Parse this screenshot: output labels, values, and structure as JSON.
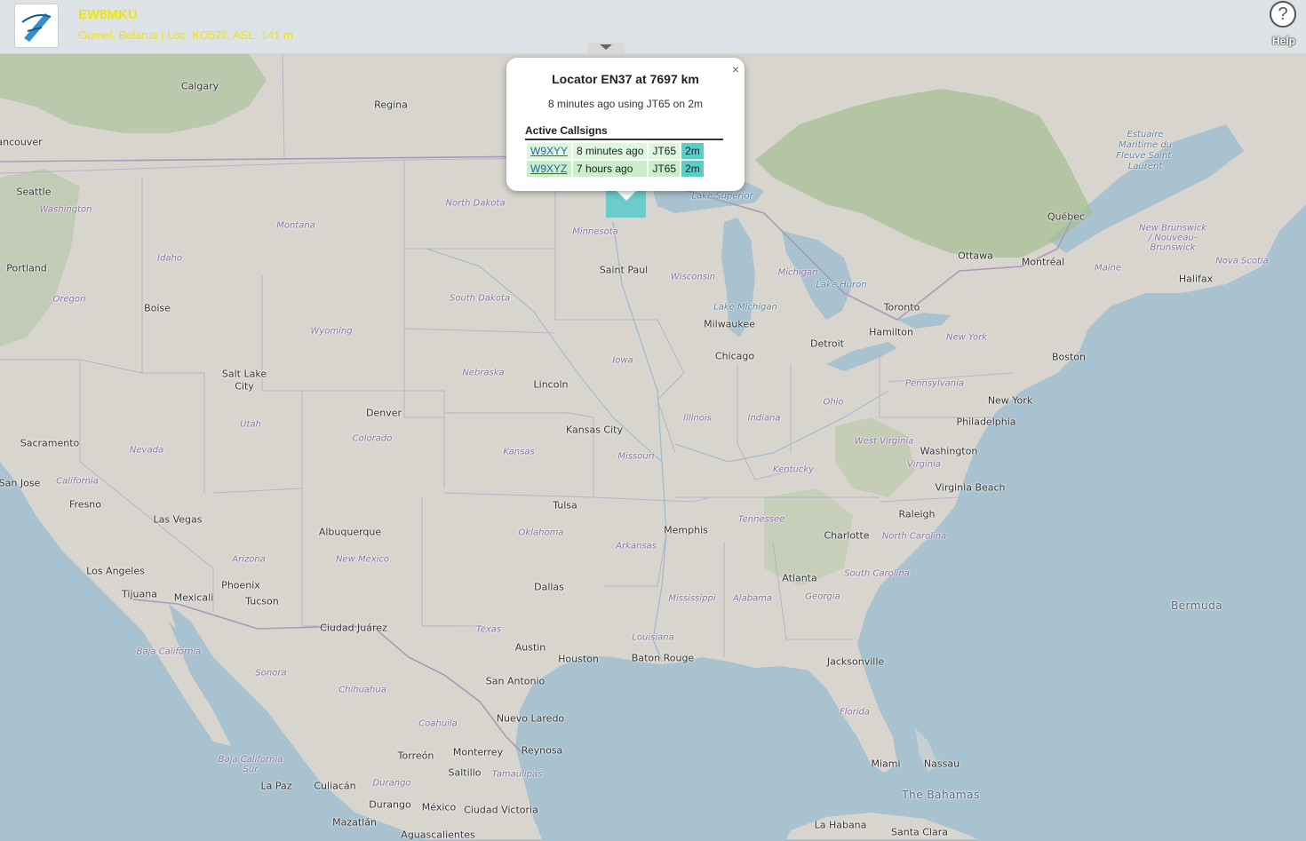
{
  "header": {
    "callsign": "EW8MKU",
    "subline": "Gomel, Belarus | Loc: KO52ll, ASL: 141 m",
    "help_label": "Help",
    "help_icon": "question-mark-icon",
    "logo_icon": "app-logo-icon"
  },
  "popup": {
    "close": "×",
    "title": "Locator EN37 at 7697 km",
    "subtitle": "8 minutes ago using JT65 on 2m",
    "heading": "Active Callsigns",
    "rows": [
      {
        "call": "W9XYY",
        "time": "8 minutes ago",
        "mode": "JT65",
        "band": "2m"
      },
      {
        "call": "W9XYZ",
        "time": "7 hours ago",
        "mode": "JT65",
        "band": "2m"
      }
    ]
  },
  "colors": {
    "header_text": "#f2e500",
    "grid_square": "#48c8cc",
    "band_cell": "#54d0c6",
    "ocean": "#a8c3cf",
    "land": "#d8d5cf"
  },
  "map_labels": {
    "cities": [
      "Calgary",
      "Regina",
      "ancouver",
      "Seattle",
      "Portland",
      "Boise",
      "Salt Lake",
      "City",
      "Denver",
      "Sacramento",
      "San Jose",
      "Fresno",
      "Las Vegas",
      "Los Angeles",
      "Tijuana",
      "Mexicali",
      "Phoenix",
      "Tucson",
      "Albuquerque",
      "Ciudad Juárez",
      "Lincoln",
      "Kansas City",
      "Tulsa",
      "Dallas",
      "Austin",
      "Houston",
      "San Antonio",
      "Nuevo Laredo",
      "Reynosa",
      "Monterrey",
      "Saltillo",
      "Torreón",
      "Culiacán",
      "Durango",
      "Mazatlán",
      "Ciudad Victoria",
      "México",
      "Aguascalientes",
      "La Paz",
      "Saint Paul",
      "Milwaukee",
      "Chicago",
      "Detroit",
      "Toronto",
      "Hamilton",
      "Ottawa",
      "Montréal",
      "Québec",
      "Halifax",
      "Boston",
      "New York",
      "Philadelphia",
      "Washington",
      "Virginia Beach",
      "Raleigh",
      "Charlotte",
      "Memphis",
      "Atlanta",
      "Baton Rouge",
      "Jacksonville",
      "Miami",
      "Nassau",
      "La Habana",
      "Santa Clara"
    ],
    "regions": [
      "Washington",
      "Montana",
      "Idaho",
      "Oregon",
      "Wyoming",
      "Nevada",
      "Utah",
      "Colorado",
      "California",
      "Arizona",
      "New Mexico",
      "North Dakota",
      "South Dakota",
      "Nebraska",
      "Kansas",
      "Oklahoma",
      "Texas",
      "Minnesota",
      "Iowa",
      "Missouri",
      "Arkansas",
      "Louisiana",
      "Wisconsin",
      "Illinois",
      "Indiana",
      "Michigan",
      "Ohio",
      "Kentucky",
      "Tennessee",
      "Mississippi",
      "Alabama",
      "Georgia",
      "Florida",
      "South Carolina",
      "North Carolina",
      "West Virginia",
      "Virginia",
      "Pennsylvania",
      "New York",
      "Maine",
      "New Brunswick / Nouveau-Brunswick",
      "Nova Scotia",
      "Baja California",
      "Baja California Sur",
      "Sonora",
      "Chihuahua",
      "Coahuila",
      "Durango",
      "Tamaulipas"
    ],
    "waters": [
      "Lake Superior",
      "Lake Michigan",
      "Lake Huron",
      "Estuaire Maritime du Fleuve Saint-Laurent"
    ],
    "islands": [
      "Bermuda",
      "The Bahamas"
    ]
  }
}
